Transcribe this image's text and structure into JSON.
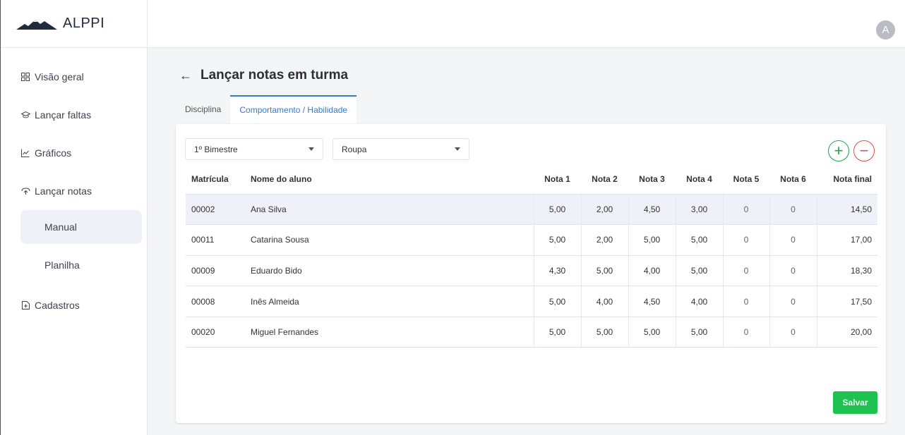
{
  "brand": {
    "name": "ALPPI"
  },
  "user": {
    "avatar_initial": "A"
  },
  "sidebar": {
    "items": [
      {
        "label": "Visão geral",
        "icon": "grid-icon"
      },
      {
        "label": "Lançar faltas",
        "icon": "graduation-cap-icon"
      },
      {
        "label": "Gráficos",
        "icon": "line-chart-icon"
      },
      {
        "label": "Lançar notas",
        "icon": "hand-icon"
      }
    ],
    "sub_items": [
      {
        "label": "Manual",
        "active": true
      },
      {
        "label": "Planilha",
        "active": false
      }
    ],
    "cadastros": {
      "label": "Cadastros",
      "icon": "document-icon"
    }
  },
  "page": {
    "title": "Lançar notas em turma",
    "back_icon": "arrow-left-icon"
  },
  "tabs": [
    {
      "label": "Disciplina",
      "active": false
    },
    {
      "label": "Comportamento / Habilidade",
      "active": true
    }
  ],
  "filters": {
    "period": "1º Bimestre",
    "category": "Roupa"
  },
  "actions": {
    "add_icon": "plus-circle-icon",
    "remove_icon": "minus-circle-icon",
    "save_label": "Salvar"
  },
  "table": {
    "headers": [
      "Matrícula",
      "Nome do aluno",
      "Nota 1",
      "Nota 2",
      "Nota 3",
      "Nota 4",
      "Nota 5",
      "Nota 6",
      "Nota final"
    ],
    "rows": [
      [
        "00002",
        "Ana Silva",
        "5,00",
        "2,00",
        "4,50",
        "3,00",
        "0",
        "0",
        "14,50"
      ],
      [
        "00011",
        "Catarina Sousa",
        "5,00",
        "2,00",
        "5,00",
        "5,00",
        "0",
        "0",
        "17,00"
      ],
      [
        "00009",
        "Eduardo Bido",
        "4,30",
        "5,00",
        "4,00",
        "5,00",
        "0",
        "0",
        "18,30"
      ],
      [
        "00008",
        "Inês Almeida",
        "5,00",
        "4,00",
        "4,50",
        "4,00",
        "0",
        "0",
        "17,50"
      ],
      [
        "00020",
        "Miguel Fernandes",
        "5,00",
        "5,00",
        "5,00",
        "5,00",
        "0",
        "0",
        "20,00"
      ]
    ]
  },
  "colors": {
    "accent": "#3c78c8",
    "success": "#1ec24f",
    "danger": "#e04b4b",
    "selected_row": "#eef1f8"
  }
}
